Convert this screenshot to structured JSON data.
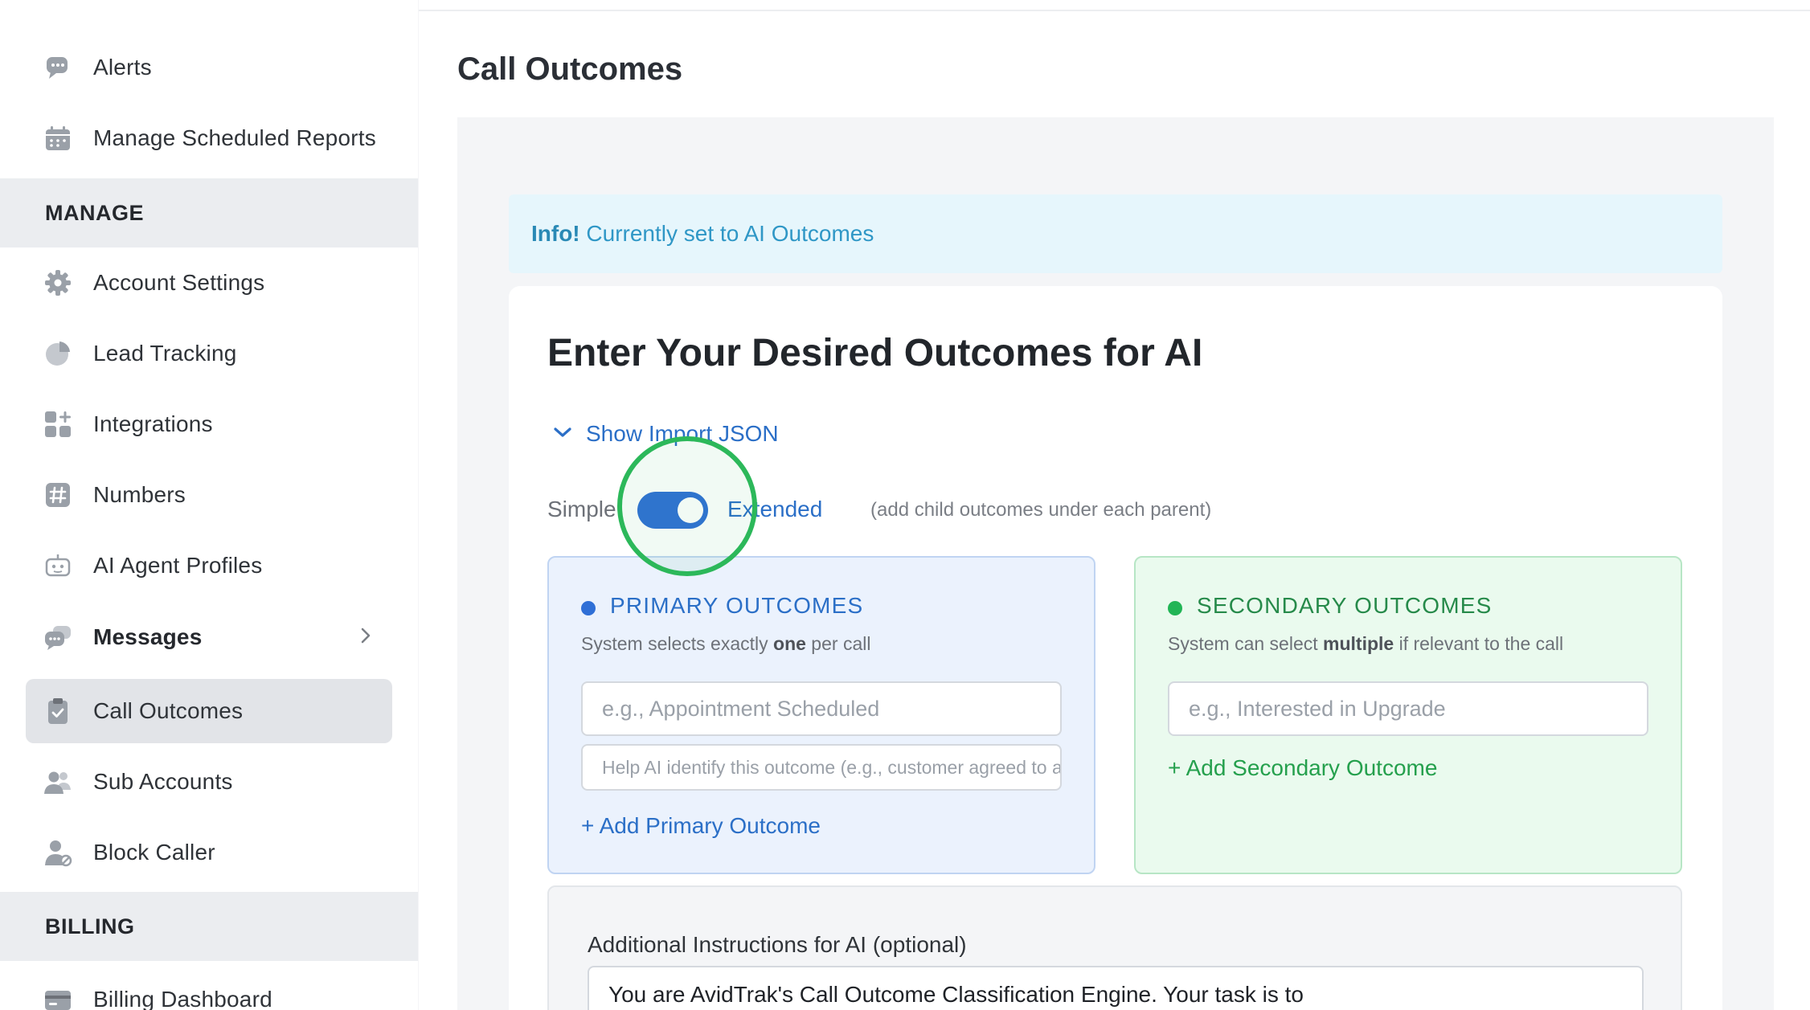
{
  "sidebar": {
    "top_items": [
      {
        "label": "Alerts",
        "icon": "chat-bubble-icon"
      },
      {
        "label": "Manage Scheduled Reports",
        "icon": "calendar-icon"
      }
    ],
    "manage_header": "MANAGE",
    "manage_items": [
      {
        "label": "Account Settings",
        "icon": "gear-icon"
      },
      {
        "label": "Lead Tracking",
        "icon": "pie-chart-icon"
      },
      {
        "label": "Integrations",
        "icon": "grid-plus-icon"
      },
      {
        "label": "Numbers",
        "icon": "hash-icon"
      },
      {
        "label": "AI Agent Profiles",
        "icon": "robot-icon"
      },
      {
        "label": "Messages",
        "icon": "chat-bubbles-icon"
      },
      {
        "label": "Call Outcomes",
        "icon": "clipboard-check-icon"
      },
      {
        "label": "Sub Accounts",
        "icon": "users-icon"
      },
      {
        "label": "Block Caller",
        "icon": "user-block-icon"
      }
    ],
    "billing_header": "BILLING",
    "billing_items": [
      {
        "label": "Billing Dashboard",
        "icon": "credit-card-icon"
      }
    ]
  },
  "main": {
    "page_title": "Call Outcomes",
    "info": {
      "prefix": "Info!",
      "text": "Currently set to AI Outcomes"
    },
    "card_title": "Enter Your Desired Outcomes for AI",
    "import_toggle": "Show Import JSON",
    "mode": {
      "left": "Simple",
      "right": "Extended",
      "hint": "(add child outcomes under each parent)",
      "selected": "Extended"
    },
    "primary": {
      "header": "PRIMARY OUTCOMES",
      "desc_before": "System selects exactly ",
      "desc_bold": "one",
      "desc_after": " per call",
      "name_placeholder": "e.g., Appointment Scheduled",
      "hint_placeholder": "Help AI identify this outcome (e.g., customer agreed to a specific time)",
      "add_label": "+ Add Primary Outcome"
    },
    "secondary": {
      "header": "SECONDARY OUTCOMES",
      "desc_before": "System can select ",
      "desc_bold": "multiple",
      "desc_after": " if relevant to the call",
      "name_placeholder": "e.g., Interested in Upgrade",
      "add_label": "+ Add Secondary Outcome"
    },
    "instructions": {
      "label": "Additional Instructions for AI (optional)",
      "value": "You are AvidTrak's Call Outcome Classification Engine. Your task is to"
    }
  },
  "colors": {
    "accent_blue": "#2f6fd6",
    "accent_green": "#22b556",
    "focus_ring": "#2cb85a",
    "info_bg": "#e6f6fc"
  }
}
